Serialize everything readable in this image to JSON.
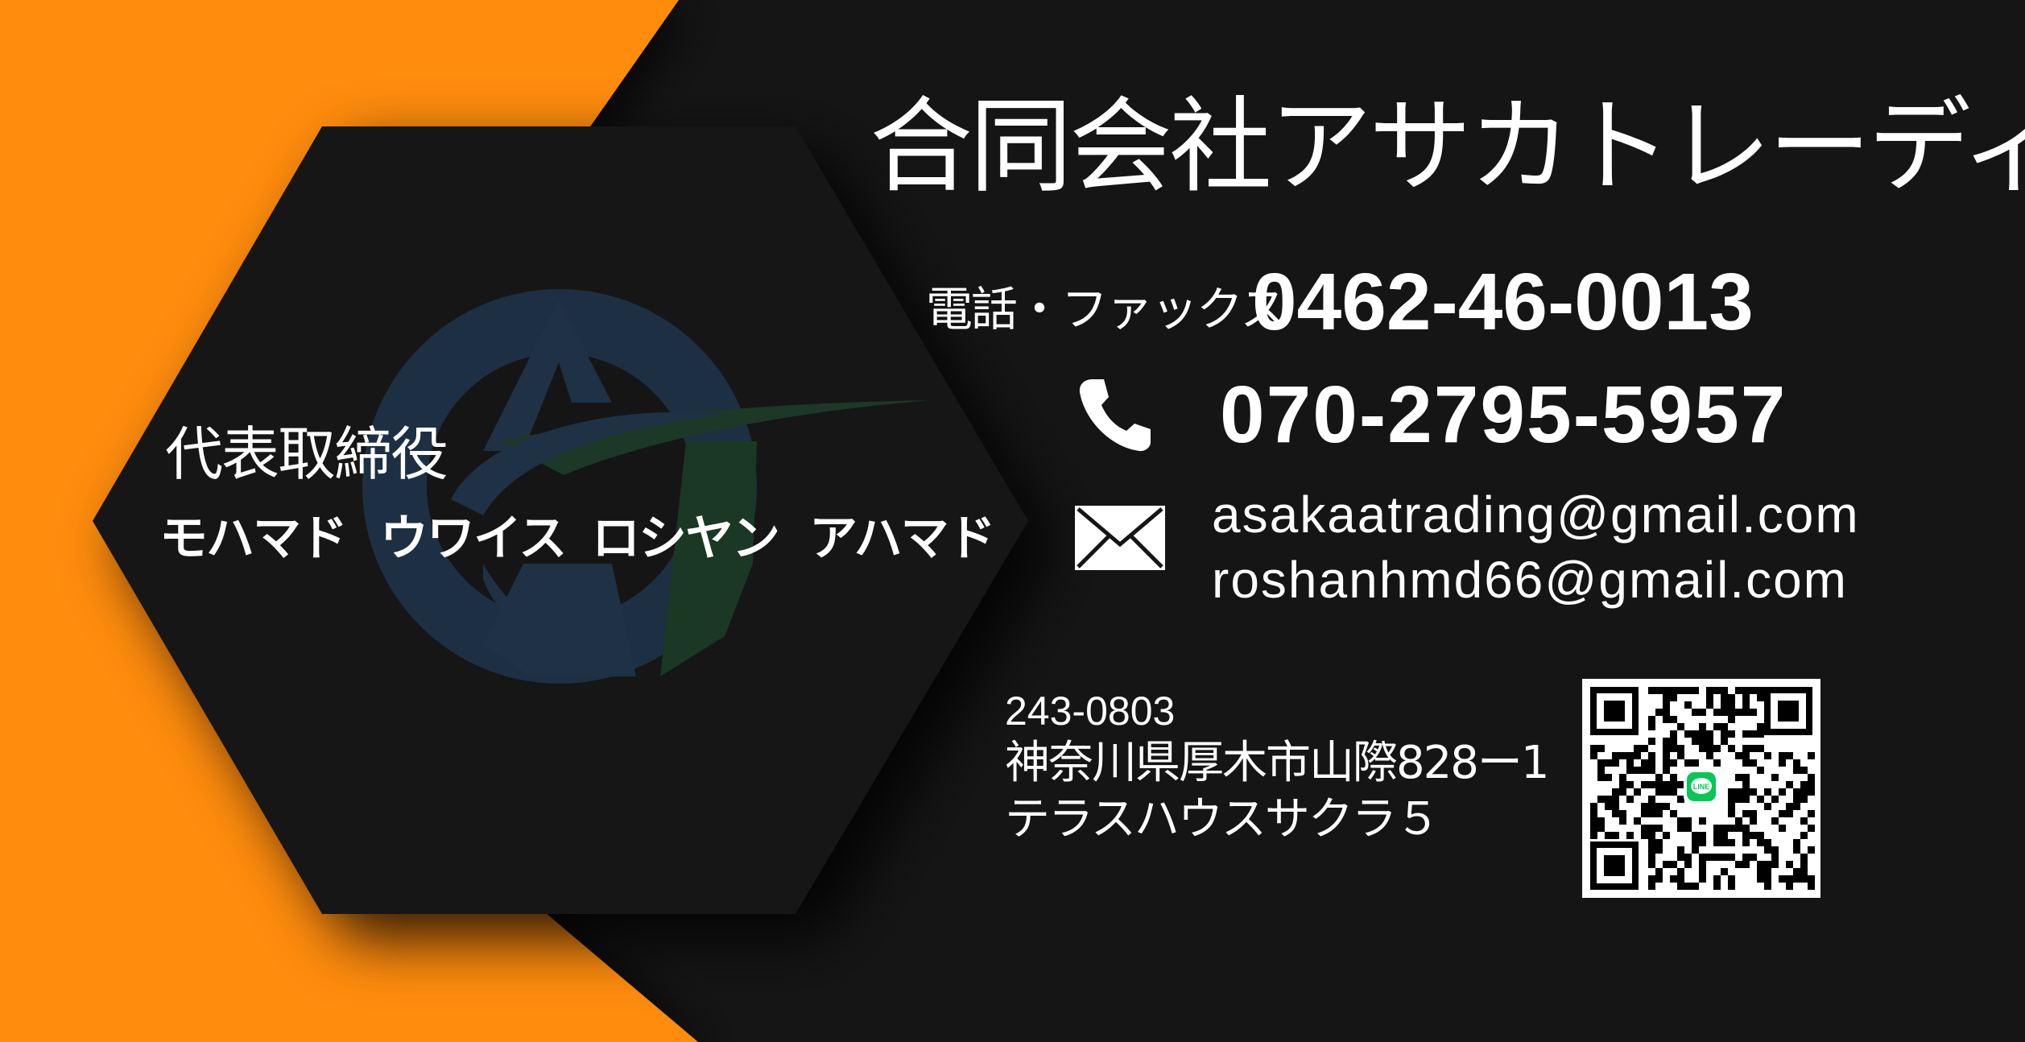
{
  "card": {
    "company_name": "合同会社アサカトレーディング",
    "contact": {
      "tel_fax_label": "電話・ファックス",
      "tel_fax_number": "0462-46-0013",
      "phone_icon": "phone-handset-icon",
      "mobile_number": "070-2795-5957",
      "mail_icon": "envelope-icon",
      "emails": [
        "asakaatrading@gmail.com",
        "roshanhmd66@gmail.com"
      ]
    },
    "address": {
      "postal_code": "243-0803",
      "street": "神奈川県厚木市山際828ー1",
      "building": "テラスハウスサクラ５"
    },
    "qr": {
      "icon": "line-qr-code",
      "badge": "LINE"
    },
    "representative": {
      "title": "代表取締役",
      "name_parts": [
        "モハマド",
        "ウワイス",
        "ロシヤン",
        "アハマド"
      ]
    },
    "colors": {
      "accent_orange": "#ff8c0a",
      "background": "#151515",
      "logo_blue": "#1f3348",
      "logo_green": "#1b3a25",
      "line_green": "#06c755"
    }
  }
}
